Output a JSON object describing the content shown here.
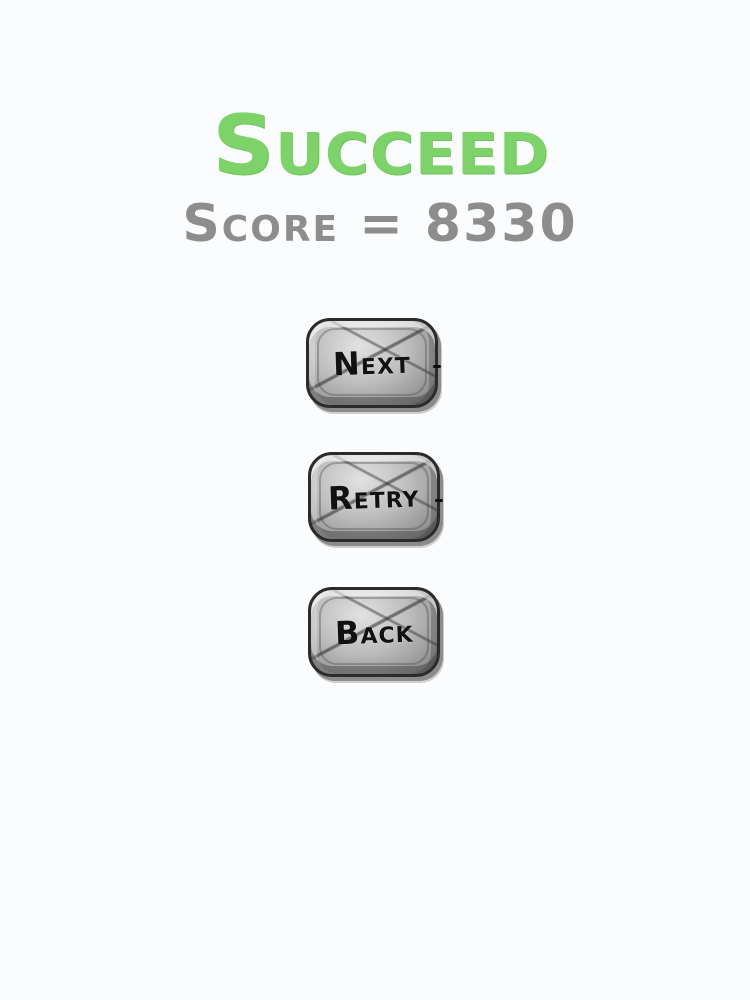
{
  "result": {
    "title": "Succeed",
    "score_label": "Score = ",
    "score_value": "8330"
  },
  "menu": {
    "next_label": "Next",
    "retry_label": "Retry",
    "back_label": "Back"
  },
  "colors": {
    "title": "#7dd26a",
    "score": "#8d8d8d",
    "button_text": "#111111",
    "background": "#fafcfd"
  }
}
